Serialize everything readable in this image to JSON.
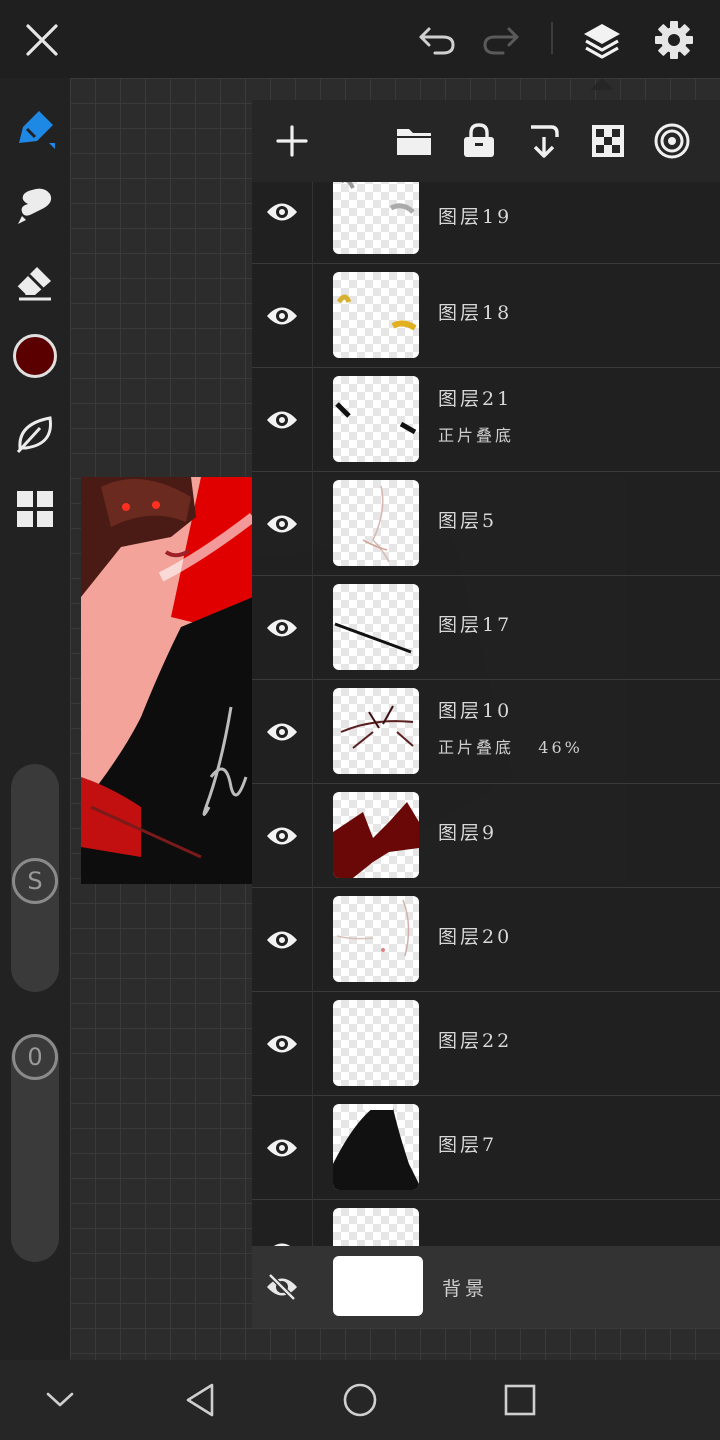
{
  "app": {
    "accent_color": "#1e88e5",
    "current_color": "#5a0000"
  },
  "topbar": {
    "icons": [
      "close-icon",
      "undo-icon",
      "redo-icon",
      "layers-icon",
      "settings-icon"
    ]
  },
  "sidebar": {
    "tools": [
      "pen-icon",
      "smudge-icon",
      "eraser-icon",
      "color-swatch",
      "leaf-icon",
      "grid-icon"
    ],
    "size_label": "S",
    "opacity_label": "0"
  },
  "layer_panel": {
    "toolbar_icons": [
      "add-icon",
      "folder-icon",
      "lock-icon",
      "merge-down-icon",
      "transparency-icon",
      "target-icon"
    ],
    "layers": [
      {
        "name": "图层19",
        "mode": "",
        "visible": true
      },
      {
        "name": "图层18",
        "mode": "",
        "visible": true
      },
      {
        "name": "图层21",
        "mode": "正片叠底",
        "visible": true
      },
      {
        "name": "图层5",
        "mode": "",
        "visible": true
      },
      {
        "name": "图层17",
        "mode": "",
        "visible": true
      },
      {
        "name": "图层10",
        "mode": "正片叠底   46%",
        "visible": true
      },
      {
        "name": "图层9",
        "mode": "",
        "visible": true
      },
      {
        "name": "图层20",
        "mode": "",
        "visible": true
      },
      {
        "name": "图层22",
        "mode": "",
        "visible": true
      },
      {
        "name": "图层7",
        "mode": "",
        "visible": true
      }
    ],
    "background_layer": {
      "name": "背景",
      "visible": false
    }
  },
  "navbar": {
    "icons": [
      "collapse-icon",
      "back-icon",
      "home-icon",
      "recents-icon"
    ]
  }
}
